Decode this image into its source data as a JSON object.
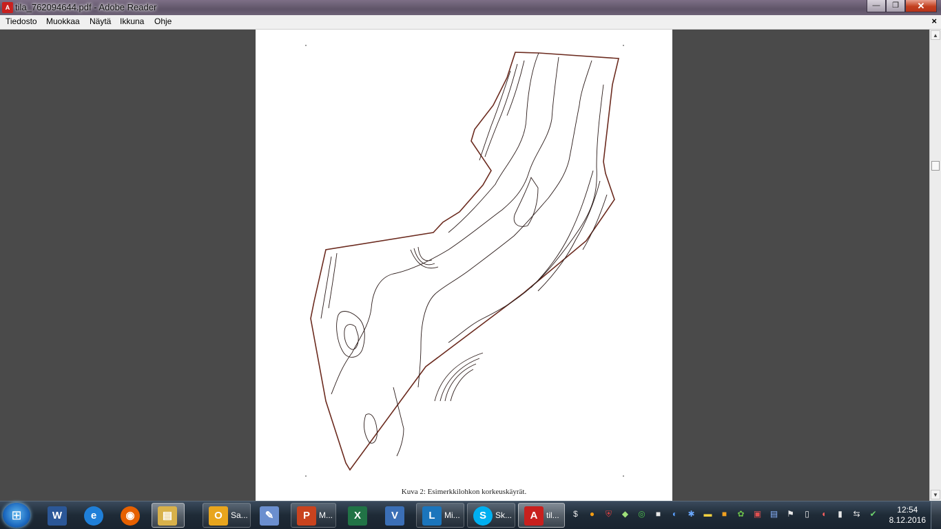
{
  "window": {
    "title": "tila_762094644.pdf - Adobe Reader",
    "minimize": "—",
    "maximize": "❐",
    "close": "✕"
  },
  "menu": [
    {
      "label": "Tiedosto"
    },
    {
      "label": "Muokkaa"
    },
    {
      "label": "Näytä"
    },
    {
      "label": "Ikkuna"
    },
    {
      "label": "Ohje"
    }
  ],
  "menu_close": "×",
  "document": {
    "caption": "Kuva 2: Esimerkkilohkon korkeuskäyrät."
  },
  "scrollbar": {
    "up": "▲",
    "down": "▼"
  },
  "taskbar": {
    "start_glyph": "⊞",
    "pinned": [
      {
        "name": "word",
        "glyph": "W",
        "color": "#2b5797"
      },
      {
        "name": "ie",
        "glyph": "e",
        "color": "#1f7fd8"
      },
      {
        "name": "firefox",
        "glyph": "◉",
        "color": "#e66000"
      },
      {
        "name": "explorer",
        "glyph": "▤",
        "color": "#d8b14a"
      }
    ],
    "apps": [
      {
        "name": "outlook",
        "glyph": "O",
        "color": "#e8a51d",
        "label": "Sa..."
      },
      {
        "name": "paint",
        "glyph": "✎",
        "color": "#6b8fcf",
        "label": ""
      },
      {
        "name": "powerpoint",
        "glyph": "P",
        "color": "#c9431e",
        "label": "M..."
      },
      {
        "name": "excel",
        "glyph": "X",
        "color": "#217346",
        "label": ""
      },
      {
        "name": "visio",
        "glyph": "V",
        "color": "#3b6fb6",
        "label": ""
      },
      {
        "name": "lync",
        "glyph": "L",
        "color": "#1b75bc",
        "label": "Mi..."
      },
      {
        "name": "skype",
        "glyph": "S",
        "color": "#00aff0",
        "label": "Sk..."
      },
      {
        "name": "adobe-reader",
        "glyph": "A",
        "color": "#c8201e",
        "label": "til..."
      }
    ],
    "tray_icons": [
      "$",
      "●",
      "⛨",
      "◆",
      "◎",
      "■",
      "◐",
      "✱",
      "▬",
      "■",
      "✿",
      "▣",
      "▤",
      "⚑",
      "▯",
      "◖",
      "▮",
      "⇆",
      "✔"
    ],
    "clock_time": "12:54",
    "clock_date": "8.12.2016"
  }
}
